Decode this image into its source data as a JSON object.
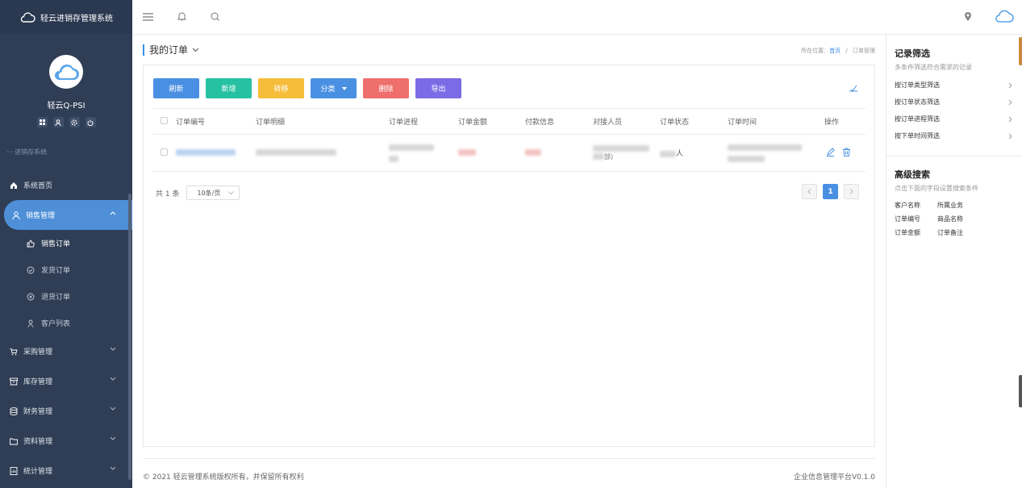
{
  "app": {
    "title": "轻云进销存管理系统"
  },
  "profile": {
    "name": "轻云Q-PSI"
  },
  "sidebar": {
    "section_label": "··· 进销存系统",
    "items": [
      {
        "label": "系统首页",
        "icon": "home-icon"
      },
      {
        "label": "销售管理",
        "icon": "user-icon",
        "active": true
      },
      {
        "label": "采购管理",
        "icon": "cart-icon"
      },
      {
        "label": "库存管理",
        "icon": "archive-icon"
      },
      {
        "label": "财务管理",
        "icon": "database-icon"
      },
      {
        "label": "资料管理",
        "icon": "folder-icon"
      },
      {
        "label": "统计管理",
        "icon": "chart-file-icon"
      }
    ],
    "sub_items": [
      {
        "label": "销售订单",
        "icon": "thumb-up-icon"
      },
      {
        "label": "发货订单",
        "icon": "check-circle-icon"
      },
      {
        "label": "退货订单",
        "icon": "x-circle-icon"
      },
      {
        "label": "客户列表",
        "icon": "person-icon"
      }
    ]
  },
  "page": {
    "title": "我的订单",
    "breadcrumb": {
      "prefix": "所在位置：",
      "home": "首页",
      "separator": "/",
      "current": "订单管理"
    }
  },
  "toolbar": {
    "refresh": "刷新",
    "new": "新增",
    "move": "转移",
    "category": "分类",
    "delete": "删除",
    "export": "导出"
  },
  "colors": {
    "refresh": "#4a90e2",
    "new": "#26c1a3",
    "move": "#f6bd3a",
    "delete": "#ef6f6c",
    "export": "#7b6ce6",
    "sidebar": "#2f3e55",
    "accent": "#4e8fd8"
  },
  "table": {
    "headers": [
      "订单编号",
      "订单明细",
      "订单进程",
      "订单金额",
      "付款信息",
      "对接人员",
      "订单状态",
      "订单时间",
      "操作"
    ],
    "row_visible_text": {
      "status_suffix": "人",
      "contact_suffix": "部)"
    }
  },
  "pagination": {
    "total": "共 1 条",
    "page_size": "10条/页",
    "current_page": "1"
  },
  "footer": {
    "copyright": "© 2021 轻云管理系统版权所有，并保留所有权利",
    "version": "企业信息管理平台V0.1.0"
  },
  "right_panel": {
    "filter_title": "记录筛选",
    "filter_desc": "多条件筛选符合需求的记录",
    "filters": [
      "按订单类型筛选",
      "按订单状态筛选",
      "按订单进程筛选",
      "按下单时间筛选"
    ],
    "adv_title": "高级搜索",
    "adv_desc": "点击下面的字段设置搜索条件",
    "fields": [
      "客户名称",
      "所属业务",
      "订单编号",
      "商品名称",
      "订单金额",
      "订单备注"
    ]
  }
}
